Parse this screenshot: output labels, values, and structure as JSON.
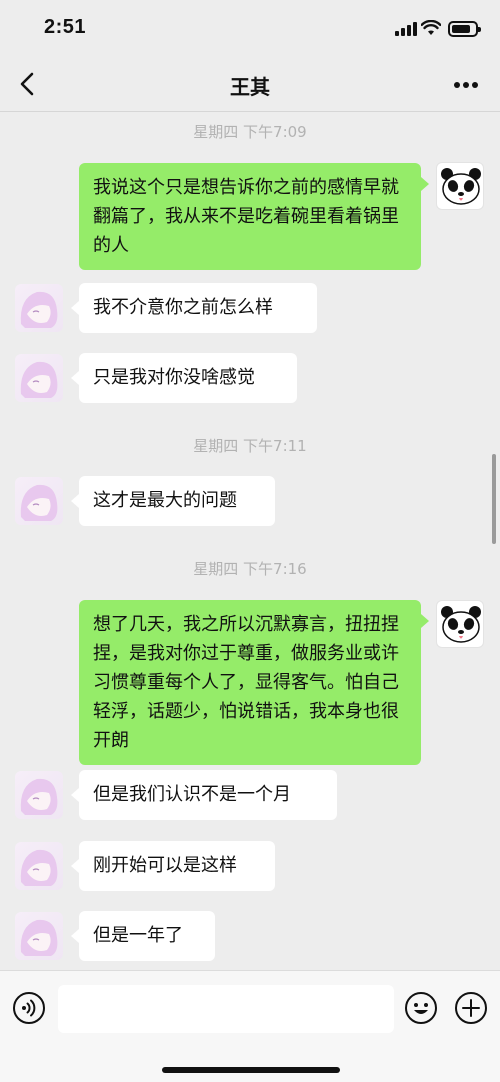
{
  "status_bar": {
    "time": "2:51",
    "icons": [
      "signal-icon",
      "wifi-icon",
      "battery-icon"
    ]
  },
  "nav": {
    "title": "王其",
    "back_icon": "chevron-left-icon",
    "more_icon": "more-icon"
  },
  "messages": [
    {
      "type": "timestamp",
      "text": "星期四 下午7:09"
    },
    {
      "type": "bubble",
      "sender": "me",
      "text": "我说这个只是想告诉你之前的感情早就翻篇了，我从来不是吃着碗里看着锅里的人"
    },
    {
      "type": "bubble",
      "sender": "other",
      "text": "我不介意你之前怎么样"
    },
    {
      "type": "bubble",
      "sender": "other",
      "text": "只是我对你没啥感觉"
    },
    {
      "type": "timestamp",
      "text": "星期四 下午7:11"
    },
    {
      "type": "bubble",
      "sender": "other",
      "text": "这才是最大的问题"
    },
    {
      "type": "timestamp",
      "text": "星期四 下午7:16"
    },
    {
      "type": "bubble",
      "sender": "me",
      "text": "想了几天，我之所以沉默寡言，扭扭捏捏，是我对你过于尊重，做服务业或许习惯尊重每个人了，显得客气。怕自己轻浮，话题少，怕说错话，我本身也很开朗"
    },
    {
      "type": "bubble",
      "sender": "other",
      "text": "但是我们认识不是一个月"
    },
    {
      "type": "bubble",
      "sender": "other",
      "text": "刚开始可以是这样"
    },
    {
      "type": "bubble",
      "sender": "other",
      "text": "但是一年了"
    }
  ],
  "input_bar": {
    "voice_icon": "voice-icon",
    "input_value": "",
    "emoji_icon": "emoji-icon",
    "plus_icon": "plus-icon"
  },
  "colors": {
    "background": "#ededed",
    "my_bubble": "#95ec69",
    "other_bubble": "#ffffff",
    "timestamp": "#b2b2b2"
  }
}
